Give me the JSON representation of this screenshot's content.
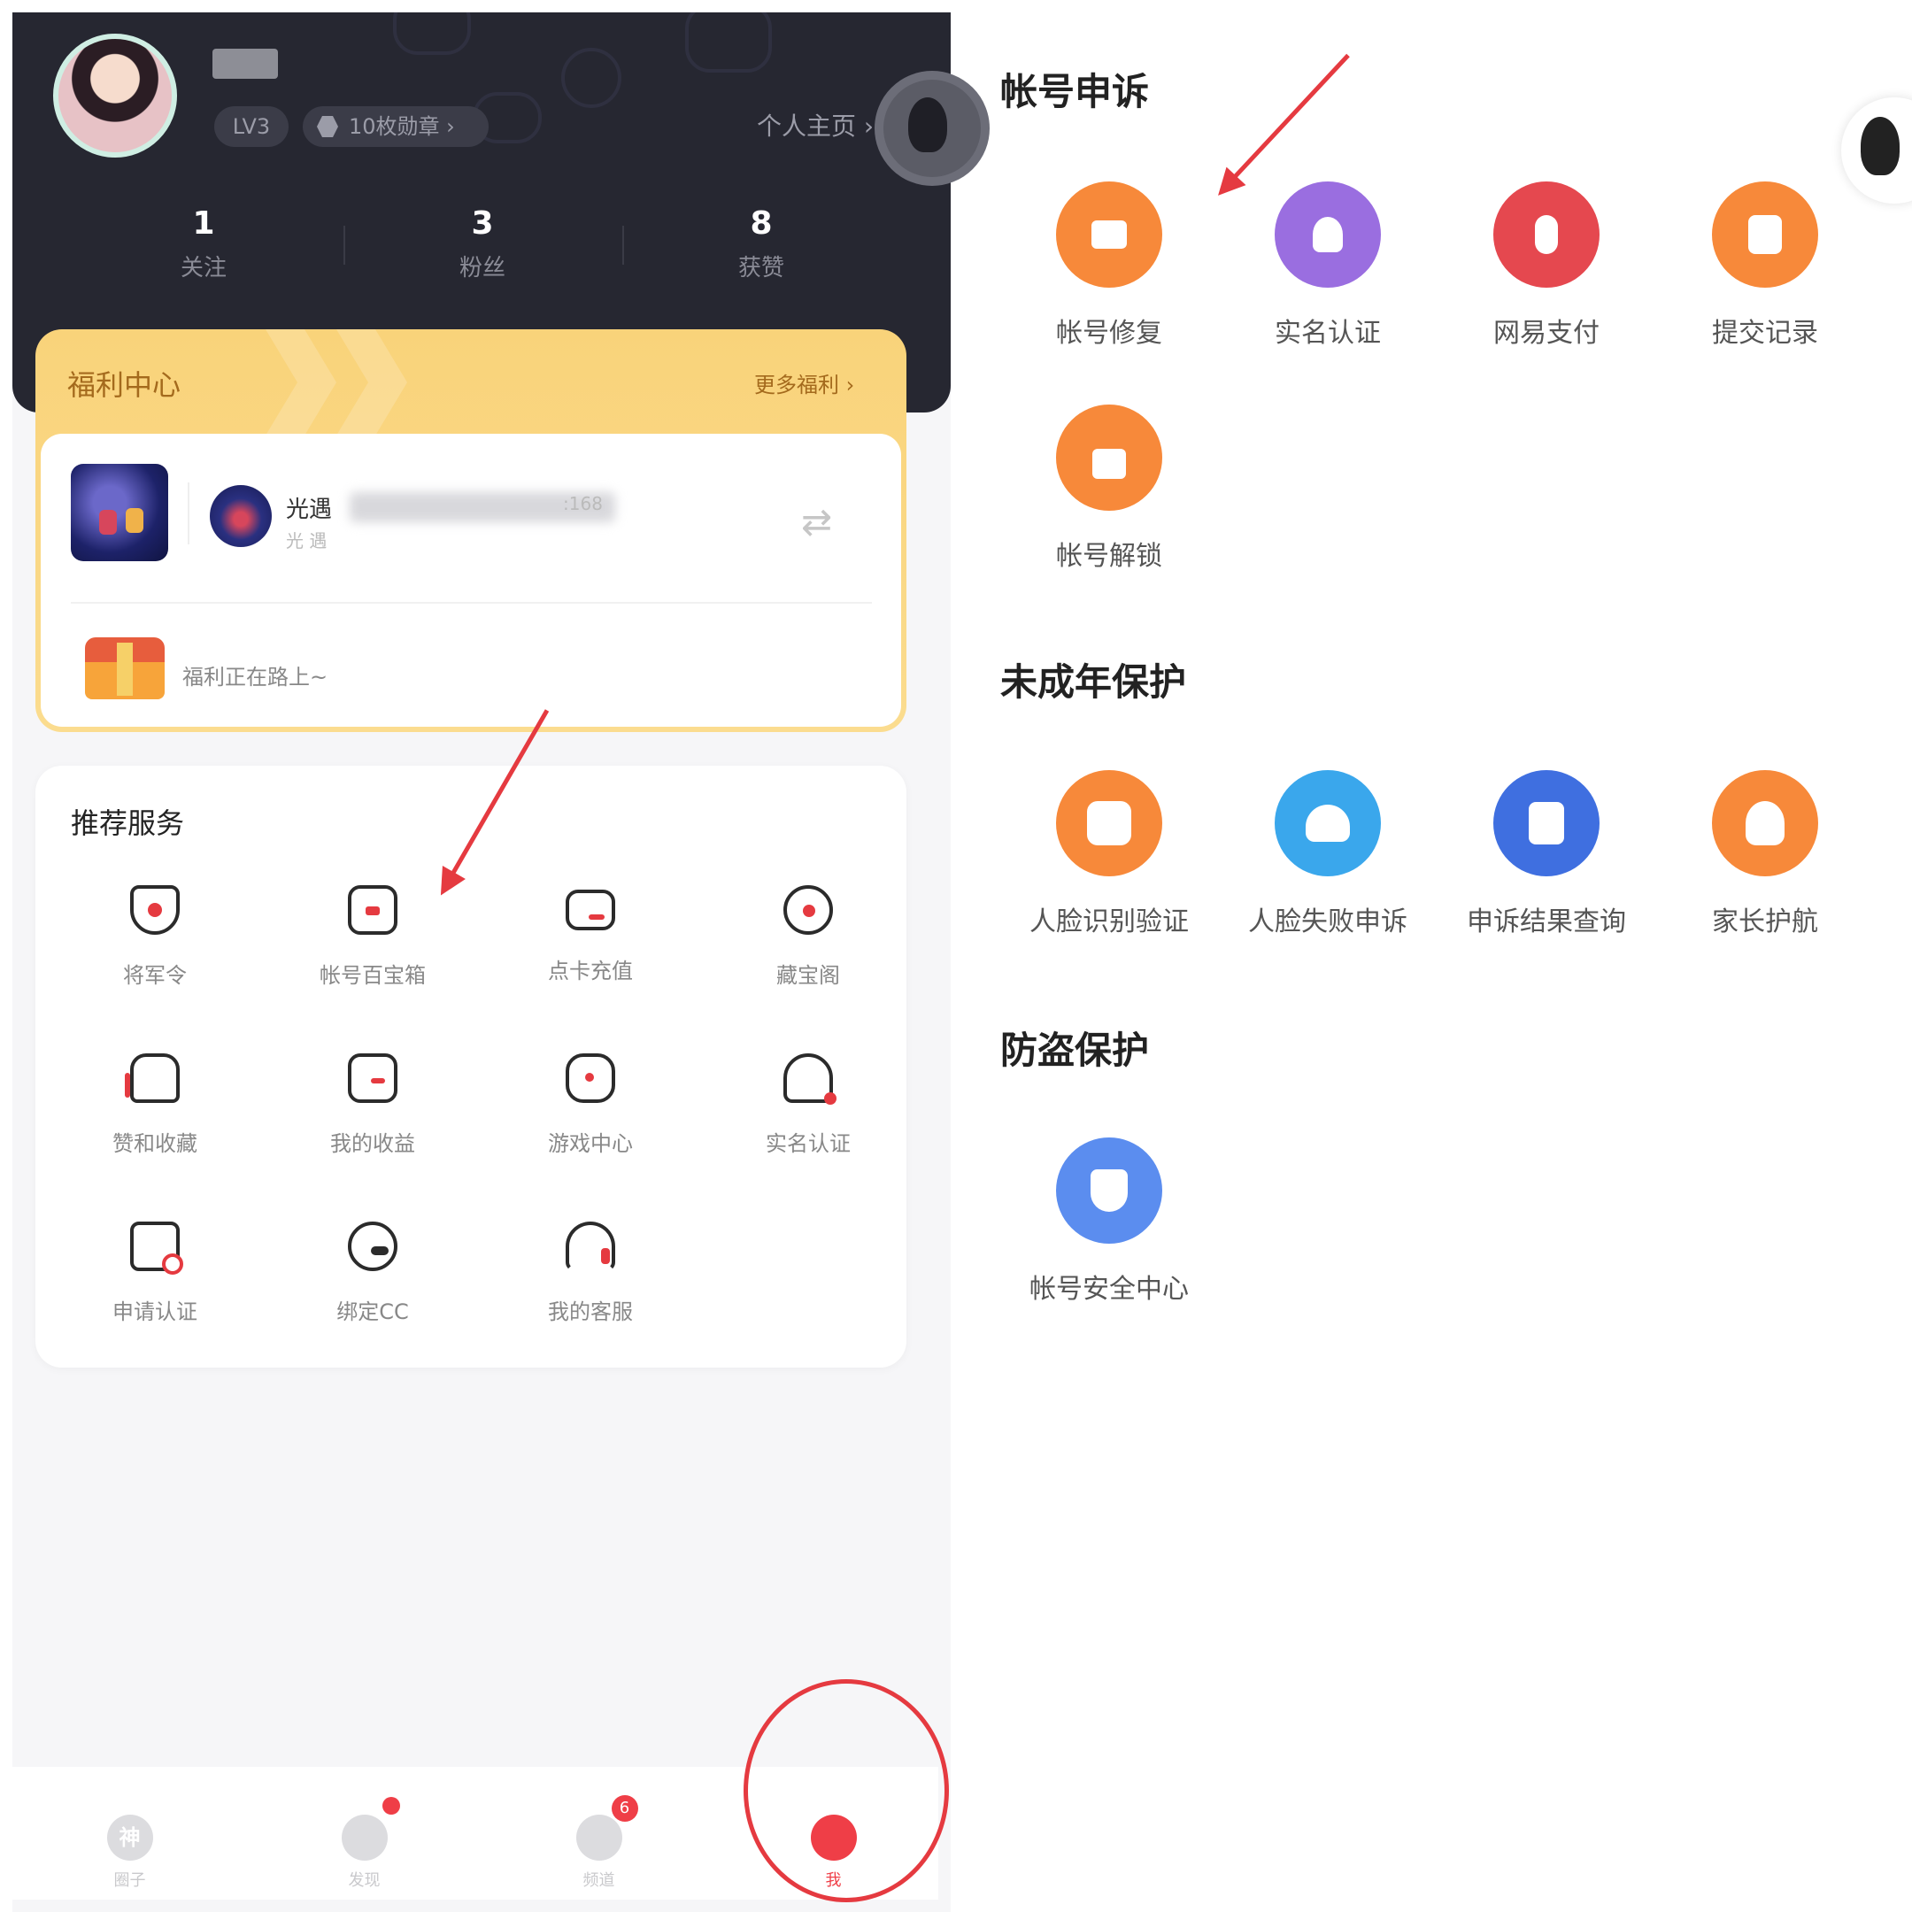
{
  "profile": {
    "level": "LV3",
    "medals": "10枚勋章",
    "homepage_link": "个人主页",
    "stats": [
      {
        "value": "1",
        "label": "关注"
      },
      {
        "value": "3",
        "label": "粉丝"
      },
      {
        "value": "8",
        "label": "获赞"
      }
    ]
  },
  "welfare": {
    "title": "福利中心",
    "more": "更多福利",
    "character_name": "光遇",
    "character_id": ":168",
    "character_sub": "光 遇",
    "status": "福利正在路上~"
  },
  "services": {
    "title": "推荐服务",
    "items": [
      {
        "label": "将军令",
        "icon": "shield-order-icon"
      },
      {
        "label": "帐号百宝箱",
        "icon": "treasure-box-icon"
      },
      {
        "label": "点卡充值",
        "icon": "card-icon"
      },
      {
        "label": "藏宝阁",
        "icon": "treasure-pavilion-icon"
      },
      {
        "label": "赞和收藏",
        "icon": "thumbs-up-icon"
      },
      {
        "label": "我的收益",
        "icon": "wallet-icon"
      },
      {
        "label": "游戏中心",
        "icon": "gamepad-icon"
      },
      {
        "label": "实名认证",
        "icon": "user-verify-icon"
      },
      {
        "label": "申请认证",
        "icon": "apply-verify-icon"
      },
      {
        "label": "绑定CC",
        "icon": "cc-bind-icon"
      },
      {
        "label": "我的客服",
        "icon": "headset-icon"
      }
    ]
  },
  "tabbar": {
    "tabs": [
      {
        "label": "圈子",
        "glyph": "神",
        "icon": "circle-tab-icon"
      },
      {
        "label": "发现",
        "glyph": "",
        "icon": "planet-tab-icon"
      },
      {
        "label": "频道",
        "glyph": "",
        "icon": "channel-tab-icon",
        "badge": "6"
      },
      {
        "label": "我",
        "glyph": "",
        "icon": "me-tab-icon"
      }
    ],
    "active_color": "#ef3e47"
  },
  "account_appeal": {
    "title": "帐号申诉",
    "items": [
      {
        "label": "帐号修复",
        "icon": "account-repair-icon",
        "color": "#f7893a"
      },
      {
        "label": "实名认证",
        "icon": "real-name-icon",
        "color": "#9a6ee0"
      },
      {
        "label": "网易支付",
        "icon": "netease-pay-icon",
        "color": "#e5484f"
      },
      {
        "label": "提交记录",
        "icon": "submit-record-icon",
        "color": "#f7893a"
      },
      {
        "label": "帐号解锁",
        "icon": "account-unlock-icon",
        "color": "#f7893a"
      }
    ]
  },
  "minor_protection": {
    "title": "未成年保护",
    "items": [
      {
        "label": "人脸识别验证",
        "icon": "face-scan-icon",
        "color": "#f7893a"
      },
      {
        "label": "人脸失败申诉",
        "icon": "headset-support-icon",
        "color": "#3aa7ec"
      },
      {
        "label": "申诉结果查询",
        "icon": "result-search-icon",
        "color": "#3f6fe0"
      },
      {
        "label": "家长护航",
        "icon": "parent-guard-icon",
        "color": "#f7893a"
      }
    ]
  },
  "anti_theft": {
    "title": "防盗保护",
    "items": [
      {
        "label": "帐号安全中心",
        "icon": "security-center-icon",
        "color": "#5b8def"
      }
    ]
  }
}
